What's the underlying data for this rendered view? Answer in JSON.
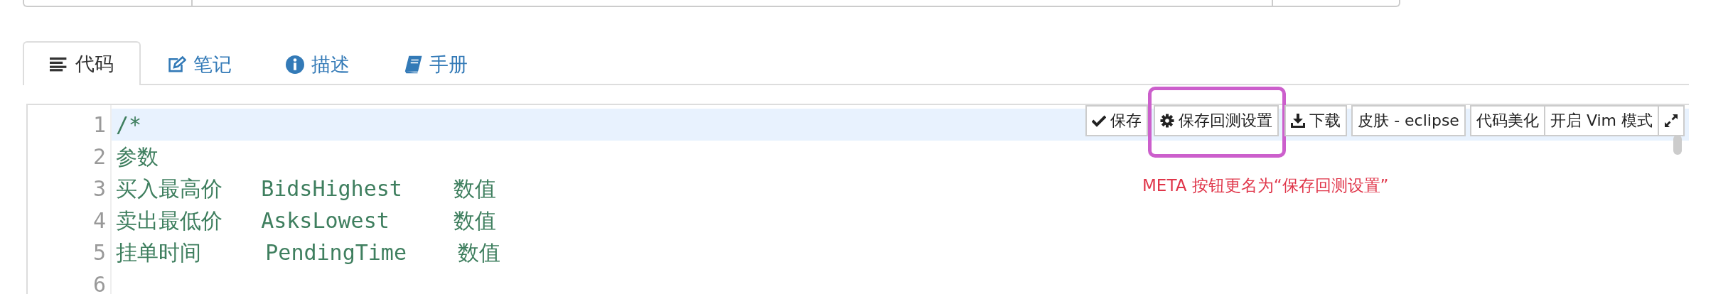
{
  "tabs": [
    {
      "label": "代码",
      "kind": "lines",
      "selected": true
    },
    {
      "label": "笔记",
      "kind": "edit",
      "selected": false
    },
    {
      "label": "描述",
      "kind": "info",
      "selected": false
    },
    {
      "label": "手册",
      "kind": "book",
      "selected": false
    }
  ],
  "toolbar": [
    {
      "label": "保存",
      "kind": "check",
      "highlighted": false
    },
    {
      "label": "保存回测设置",
      "kind": "gear",
      "highlighted": true
    },
    {
      "label": "下载",
      "kind": "download",
      "highlighted": false
    },
    {
      "label": "皮肤 - eclipse",
      "kind": "text",
      "highlighted": false
    },
    {
      "label": "代码美化",
      "kind": "text",
      "highlighted": false
    },
    {
      "label": "开启 Vim 模式",
      "kind": "text",
      "highlighted": false
    },
    {
      "kind": "expand",
      "highlighted": false
    }
  ],
  "annotation": "META 按钮更名为“保存回测设置”",
  "editor": {
    "lines": [
      {
        "number": "1",
        "text": "/*",
        "active": true
      },
      {
        "number": "2",
        "text": "参数",
        "active": false
      },
      {
        "number": "3",
        "text": "买入最高价   BidsHighest    数值",
        "active": false
      },
      {
        "number": "4",
        "text": "卖出最低价   AsksLowest     数值",
        "active": false
      },
      {
        "number": "5",
        "text": "挂单时间     PendingTime    数值",
        "active": false
      },
      {
        "number": "6",
        "active": false
      }
    ]
  }
}
